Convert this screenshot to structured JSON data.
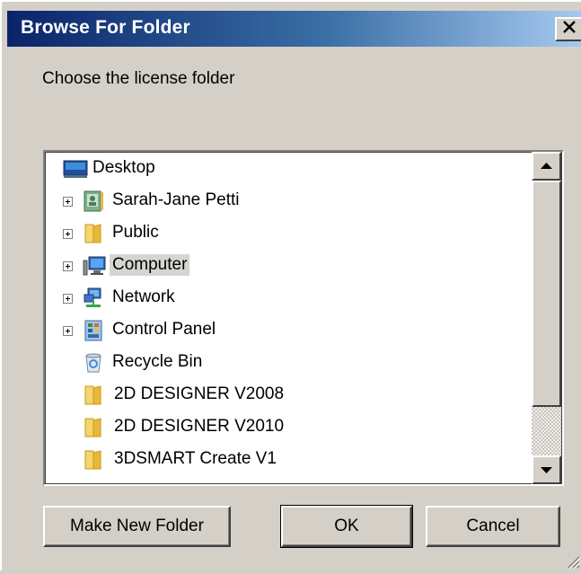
{
  "window": {
    "title": "Browse For Folder",
    "close_glyph": "✕"
  },
  "prompt": "Choose the license folder",
  "tree": {
    "items": [
      {
        "label": "Desktop",
        "icon": "desktop-icon",
        "expandable": false,
        "selected": false
      },
      {
        "label": "Sarah-Jane Petti",
        "icon": "user-folder-icon",
        "expandable": true,
        "selected": false
      },
      {
        "label": "Public",
        "icon": "folder-icon",
        "expandable": true,
        "selected": false
      },
      {
        "label": "Computer",
        "icon": "computer-icon",
        "expandable": true,
        "selected": true
      },
      {
        "label": "Network",
        "icon": "network-icon",
        "expandable": true,
        "selected": false
      },
      {
        "label": "Control Panel",
        "icon": "control-panel-icon",
        "expandable": true,
        "selected": false
      },
      {
        "label": "Recycle Bin",
        "icon": "recycle-bin-icon",
        "expandable": false,
        "selected": false
      },
      {
        "label": "2D DESIGNER V2008",
        "icon": "folder-icon",
        "expandable": false,
        "selected": false
      },
      {
        "label": "2D DESIGNER V2010",
        "icon": "folder-icon",
        "expandable": false,
        "selected": false
      },
      {
        "label": "3DSMART Create V1",
        "icon": "folder-icon",
        "expandable": false,
        "selected": false
      }
    ]
  },
  "buttons": {
    "make_new_folder": "Make New Folder",
    "ok": "OK",
    "cancel": "Cancel"
  },
  "colors": {
    "titlebar_start": "#0a246a",
    "titlebar_end": "#a6caf0",
    "dialog_bg": "#d4d0c8",
    "selection_bg": "#d7d5d0"
  }
}
